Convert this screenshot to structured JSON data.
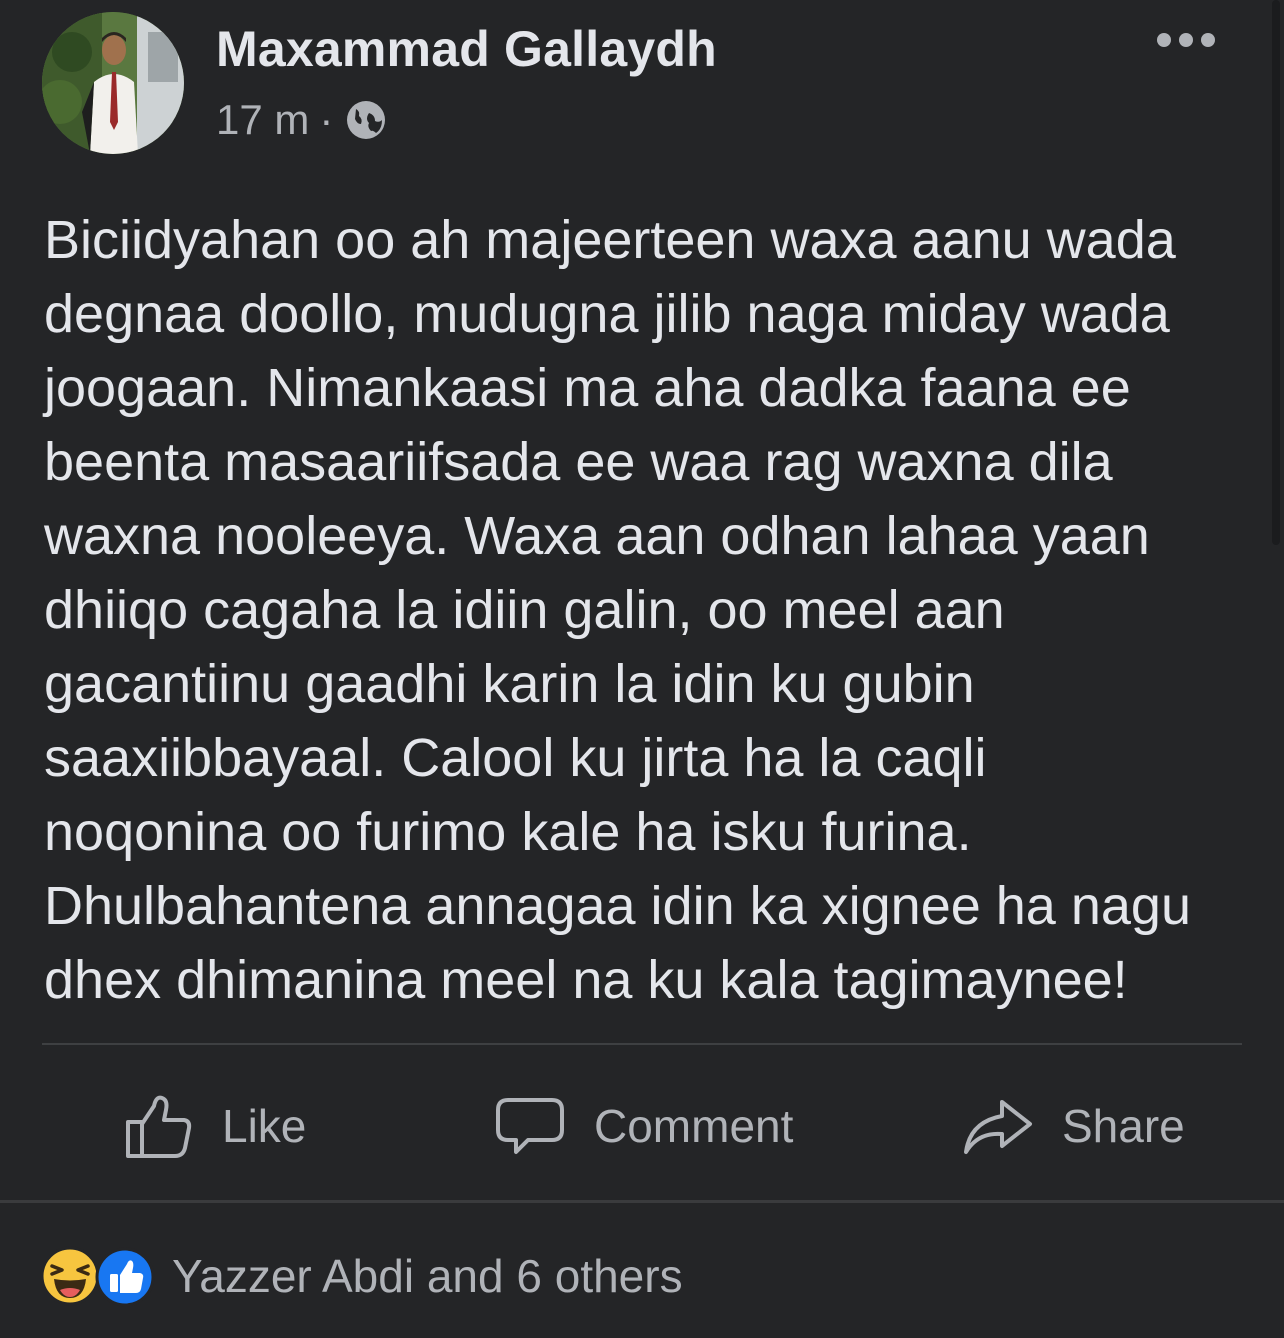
{
  "post": {
    "author": "Maxammad Gallaydh",
    "time": "17 m",
    "separator": "·",
    "privacy_icon": "globe-icon",
    "more_icon": "ellipsis-icon",
    "body": "Biciidyahan oo ah majeerteen waxa aanu wada\ndegnaa doollo, mudugna jilib naga miday wada\njoogaan. Nimankaasi ma aha dadka faana ee\nbeenta masaariifsada ee waa rag waxna dila\nwaxna nooleeya. Waxa aan odhan lahaa yaan\ndhiiqo cagaha la idiin galin, oo meel aan\ngacantiinu gaadhi karin la idin ku gubin\nsaaxiibbayaal.  Calool ku jirta ha la caqli\nnoqonina oo furimo kale ha isku furina.\nDhulbahantena annagaa idin ka xignee ha nagu\ndhex dhimanina meel na ku kala tagimaynee!"
  },
  "actions": {
    "like_label": "Like",
    "comment_label": "Comment",
    "share_label": "Share"
  },
  "reactions": {
    "icons": [
      "haha-icon",
      "like-icon"
    ],
    "summary": "Yazzer Abdi and 6 others"
  },
  "colors": {
    "background": "#242527",
    "text_primary": "#e4e6eb",
    "text_secondary": "#b0b3b8",
    "like_blue": "#1877f2",
    "haha_yellow": "#f7c53f"
  }
}
